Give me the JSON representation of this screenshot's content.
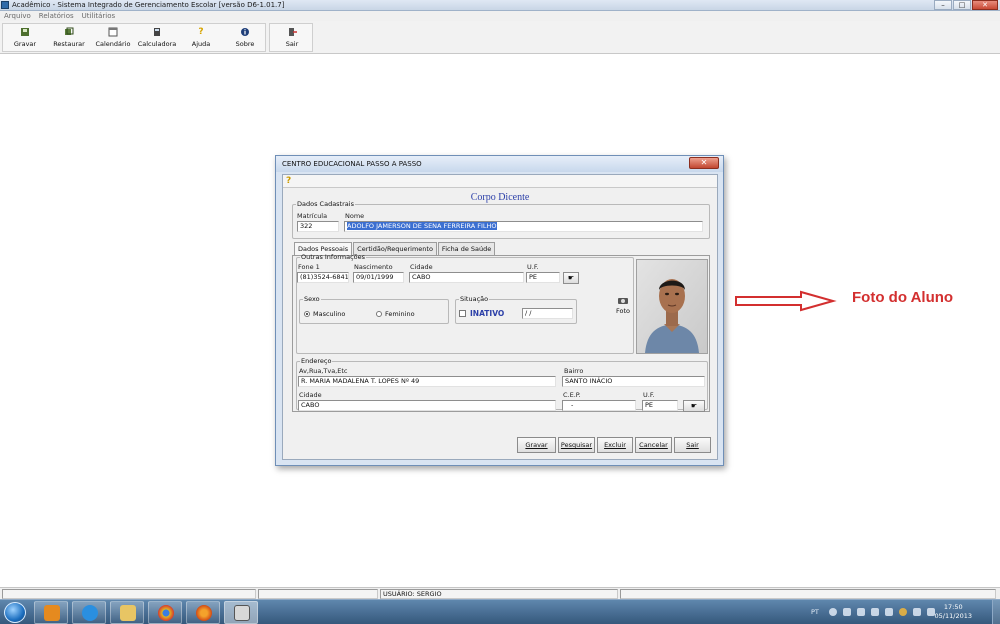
{
  "window": {
    "title": "Acadêmico - Sistema Integrado de Gerenciamento Escolar [versão D6-1.01.7]",
    "controls": {
      "minimize": "–",
      "maximize": "□",
      "close": "✕"
    }
  },
  "menu": [
    "Arquivo",
    "Relatórios",
    "Utilitários"
  ],
  "toolbar": {
    "buttons": [
      {
        "label": "Gravar",
        "icon": "save-icon"
      },
      {
        "label": "Restaurar",
        "icon": "restore-icon"
      },
      {
        "label": "Calendário",
        "icon": "calendar-icon"
      },
      {
        "label": "Calculadora",
        "icon": "calculator-icon"
      },
      {
        "label": "Ajuda",
        "icon": "help-icon"
      },
      {
        "label": "Sobre",
        "icon": "info-icon"
      }
    ],
    "exit_label": "Sair"
  },
  "dialog": {
    "title": "CENTRO EDUCACIONAL PASSO A PASSO",
    "close": "✕",
    "help": "?",
    "heading": "Corpo Dicente",
    "dados_cadastrais": {
      "legend": "Dados Cadastrais",
      "matricula_label": "Matrícula",
      "matricula": "322",
      "nome_label": "Nome",
      "nome": "ADOLFO JAMERSON DE SENA FERREIRA FILHO"
    },
    "tabs": [
      "Dados Pessoais",
      "Certidão/Requerimento",
      "Ficha de Saúde"
    ],
    "outras": {
      "legend": "Outras Informações",
      "fone_label": "Fone 1",
      "fone": "(81)3524-6841",
      "nascimento_label": "Nascimento",
      "nascimento": "09/01/1999",
      "cidade_label": "Cidade",
      "cidade": "CABO",
      "uf_label": "U.F.",
      "uf": "PE"
    },
    "sexo": {
      "legend": "Sexo",
      "masculino": "Masculino",
      "feminino": "Feminino",
      "selected": "Masculino"
    },
    "situacao": {
      "legend": "Situação",
      "inativo_label": "INATIVO",
      "date": "/ /"
    },
    "foto_label": "Foto",
    "endereco": {
      "legend": "Endereço",
      "rua_label": "Av,Rua,Tva,Etc",
      "rua": "R. MARIA MADALENA T. LOPES Nº 49",
      "bairro_label": "Bairro",
      "bairro": "SANTO INÁCIO",
      "cidade_label": "Cidade",
      "cidade": "CABO",
      "cep_label": "C.E.P.",
      "cep": "-",
      "uf_label": "U.F.",
      "uf": "PE"
    },
    "buttons": [
      "Gravar",
      "Pesquisar",
      "Excluir",
      "Cancelar",
      "Sair"
    ]
  },
  "status": {
    "usuario": "USUÁRIO: SERGIO"
  },
  "taskbar": {
    "lang": "PT",
    "time": "17:50",
    "date": "05/11/2013"
  },
  "annotation": {
    "text": "Foto do Aluno",
    "color": "#d32f2f"
  }
}
